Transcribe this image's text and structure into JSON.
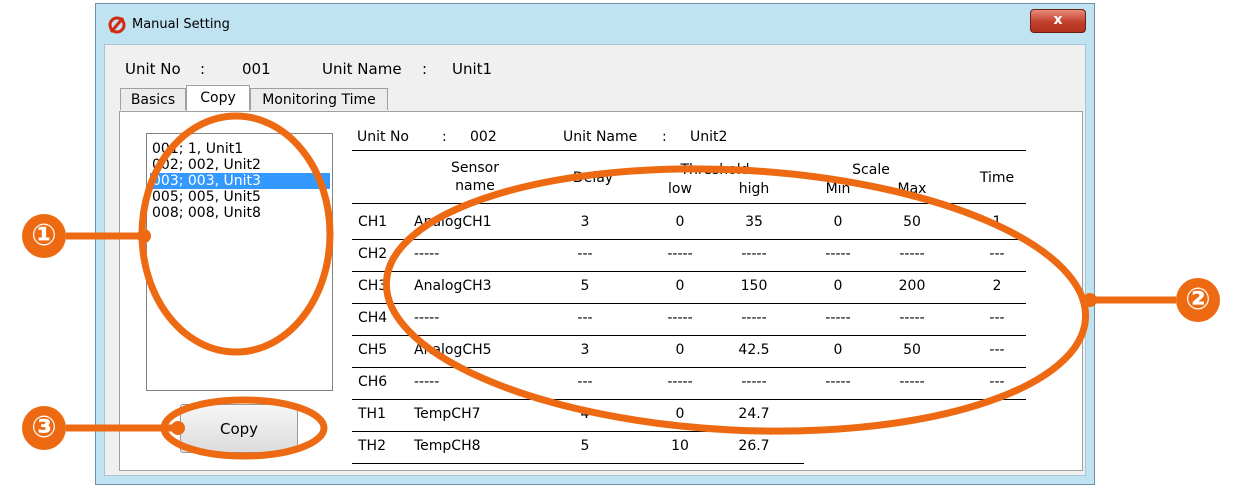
{
  "window": {
    "title": "Manual Setting",
    "close_glyph": "x"
  },
  "unit": {
    "no_label": "Unit No",
    "sep": ":",
    "no_value": "001",
    "name_label": "Unit Name",
    "name_value": "Unit1"
  },
  "tabs": [
    {
      "label": "Basics"
    },
    {
      "label": "Copy",
      "active": true
    },
    {
      "label": "Monitoring Time"
    }
  ],
  "list": {
    "items": [
      "001; 1, Unit1",
      "002; 002, Unit2",
      "003; 003, Unit3",
      "005; 005, Unit5",
      "008; 008, Unit8"
    ],
    "selected_index": 2
  },
  "copy_button": "Copy",
  "detail": {
    "unit_no_label": "Unit No",
    "sep": ":",
    "unit_no_value": "002",
    "unit_name_label": "Unit Name",
    "unit_name_value": "Unit2",
    "headers": {
      "sensor1": "Sensor",
      "sensor2": "name",
      "delay": "Delay",
      "threshold": "Threshold",
      "low": "low",
      "high": "high",
      "scale": "Scale",
      "min": "Min",
      "max": "Max",
      "time": "Time"
    },
    "rows": [
      {
        "ch": "CH1",
        "name": "AnalogCH1",
        "delay": "3",
        "low": "0",
        "high": "35",
        "min": "0",
        "max": "50",
        "time": "1"
      },
      {
        "ch": "CH2",
        "name": "-----",
        "delay": "---",
        "low": "-----",
        "high": "-----",
        "min": "-----",
        "max": "-----",
        "time": "---"
      },
      {
        "ch": "CH3",
        "name": "AnalogCH3",
        "delay": "5",
        "low": "0",
        "high": "150",
        "min": "0",
        "max": "200",
        "time": "2"
      },
      {
        "ch": "CH4",
        "name": "-----",
        "delay": "---",
        "low": "-----",
        "high": "-----",
        "min": "-----",
        "max": "-----",
        "time": "---"
      },
      {
        "ch": "CH5",
        "name": "AnalogCH5",
        "delay": "3",
        "low": "0",
        "high": "42.5",
        "min": "0",
        "max": "50",
        "time": "---"
      },
      {
        "ch": "CH6",
        "name": "-----",
        "delay": "---",
        "low": "-----",
        "high": "-----",
        "min": "-----",
        "max": "-----",
        "time": "---"
      },
      {
        "ch": "TH1",
        "name": "TempCH7",
        "delay": "4",
        "low": "0",
        "high": "24.7",
        "min": "",
        "max": "",
        "time": ""
      },
      {
        "ch": "TH2",
        "name": "TempCH8",
        "delay": "5",
        "low": "10",
        "high": "26.7",
        "min": "",
        "max": "",
        "time": ""
      }
    ]
  },
  "annotations": [
    "①",
    "②",
    "③"
  ],
  "colors": {
    "accent": "#ee6a12",
    "selection": "#3399ff",
    "window_frame": "#bfe3f1"
  }
}
